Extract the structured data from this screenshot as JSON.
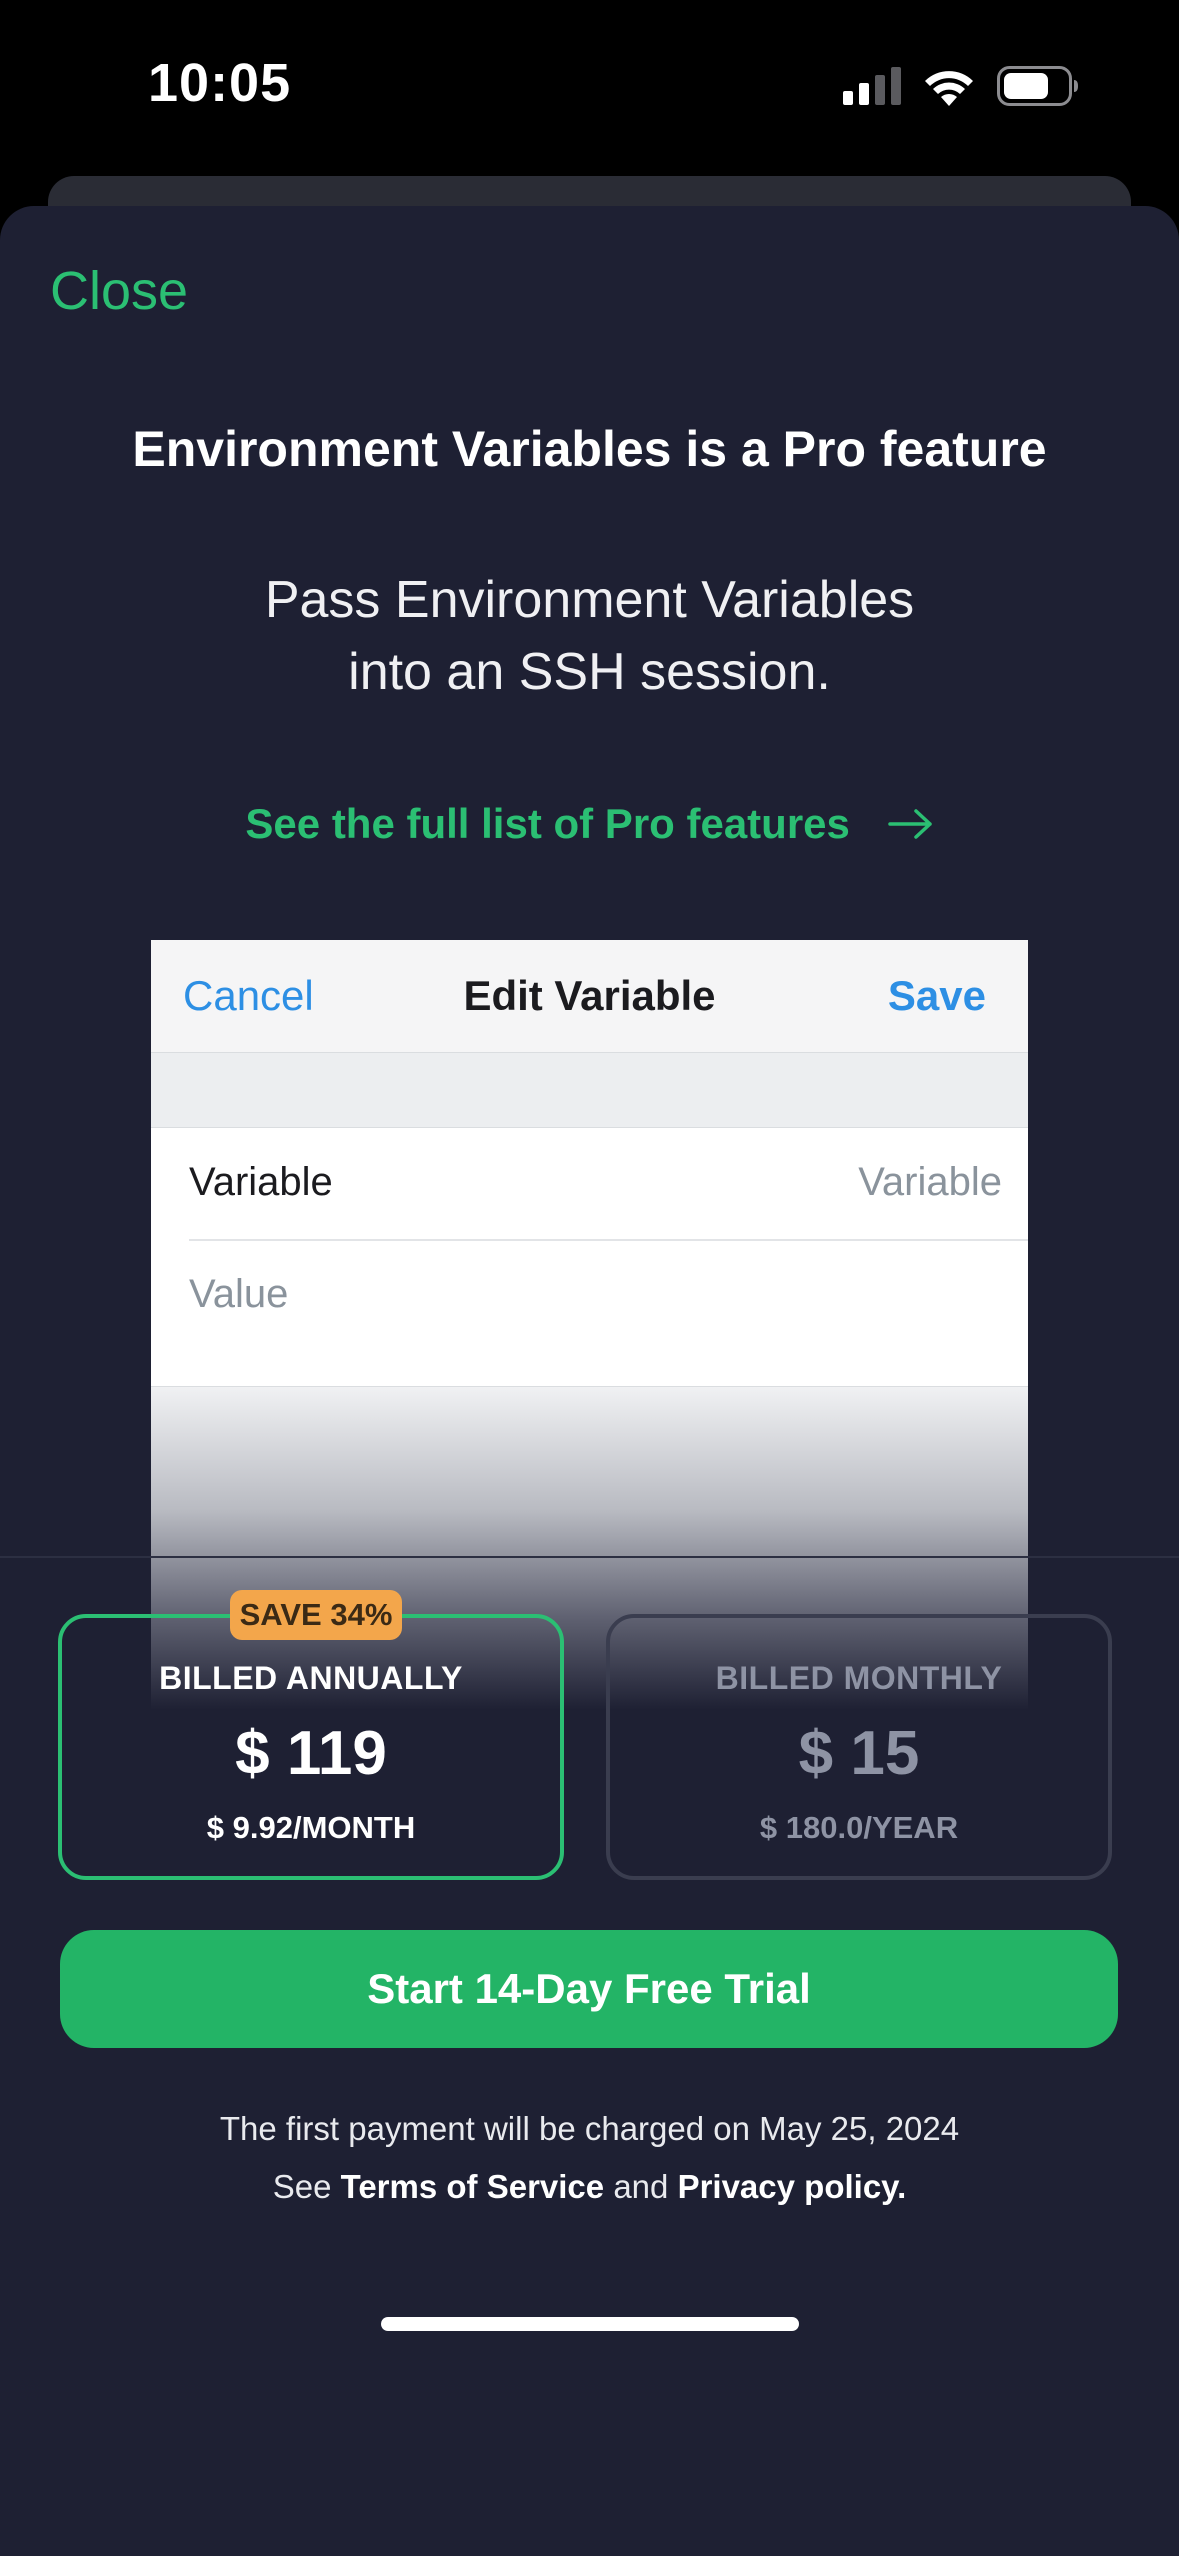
{
  "status_bar": {
    "time": "10:05",
    "icons": [
      "signal-icon",
      "wifi-icon",
      "battery-icon"
    ]
  },
  "header": {
    "close_label": "Close"
  },
  "main": {
    "title": "Environment Variables is a Pro feature",
    "subtitle_line1": "Pass Environment Variables",
    "subtitle_line2": "into an SSH session.",
    "features_link": "See the full list of Pro features"
  },
  "preview": {
    "cancel_label": "Cancel",
    "title": "Edit Variable",
    "save_label": "Save",
    "variable_label": "Variable",
    "variable_placeholder": "Variable",
    "value_placeholder": "Value"
  },
  "plans": {
    "annual": {
      "badge": "SAVE 34%",
      "name": "BILLED ANNUALLY",
      "price": "$ 119",
      "sub": "$ 9.92/MONTH",
      "selected": true
    },
    "monthly": {
      "name": "BILLED MONTHLY",
      "price": "$ 15",
      "sub": "$ 180.0/YEAR",
      "selected": false
    }
  },
  "cta": {
    "label": "Start 14-Day Free Trial"
  },
  "footer": {
    "payment_note": "The first payment will be charged on May 25, 2024",
    "see": "See",
    "terms": "Terms of Service",
    "and": "and",
    "privacy": "Privacy policy."
  },
  "colors": {
    "background": "#1e2033",
    "accent": "#2bbf73",
    "cta": "#23b466",
    "badge": "#f3a64b",
    "link_blue": "#2d8fe4"
  }
}
